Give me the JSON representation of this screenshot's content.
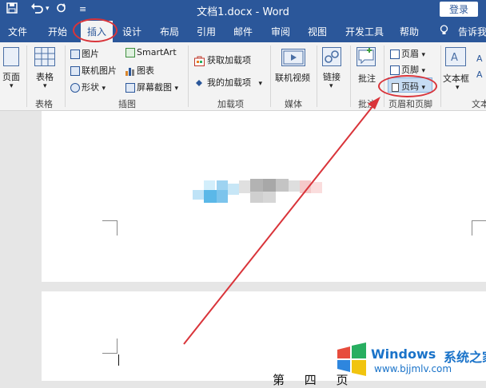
{
  "window": {
    "title": "文档1.docx - Word",
    "login_label": "登录",
    "qa_customize": "≡"
  },
  "tabs": [
    {
      "label": "文件"
    },
    {
      "label": "开始"
    },
    {
      "label": "插入",
      "active": true
    },
    {
      "label": "设计"
    },
    {
      "label": "布局"
    },
    {
      "label": "引用"
    },
    {
      "label": "邮件"
    },
    {
      "label": "审阅"
    },
    {
      "label": "视图"
    },
    {
      "label": "开发工具"
    },
    {
      "label": "帮助"
    },
    {
      "label": "告诉我"
    }
  ],
  "ribbon": {
    "pages": {
      "label": "页面",
      "group": ""
    },
    "table": {
      "label": "表格",
      "group": "表格"
    },
    "illustrations": {
      "group": "插图",
      "picture": "图片",
      "online_picture": "联机图片",
      "shapes": "形状",
      "smartart": "SmartArt",
      "chart": "图表",
      "screenshot": "屏幕截图"
    },
    "addins": {
      "group": "加载项",
      "get": "获取加载项",
      "my": "我的加载项"
    },
    "media": {
      "group": "媒体",
      "online_video": "联机视频"
    },
    "links": {
      "label": "链接"
    },
    "comments": {
      "group": "批注",
      "comment": "批注"
    },
    "header_footer": {
      "group": "页眉和页脚",
      "header": "页眉",
      "footer": "页脚",
      "page_number": "页码"
    },
    "text": {
      "group": "文本",
      "textbox": "文本框"
    }
  },
  "document": {
    "page_text": "第 四 页"
  },
  "watermark": {
    "brand": "Windows",
    "suffix": "系统之家",
    "url": "www.bjjmlv.com"
  },
  "colors": {
    "accent": "#2b579a",
    "annotation": "#d9343a"
  }
}
